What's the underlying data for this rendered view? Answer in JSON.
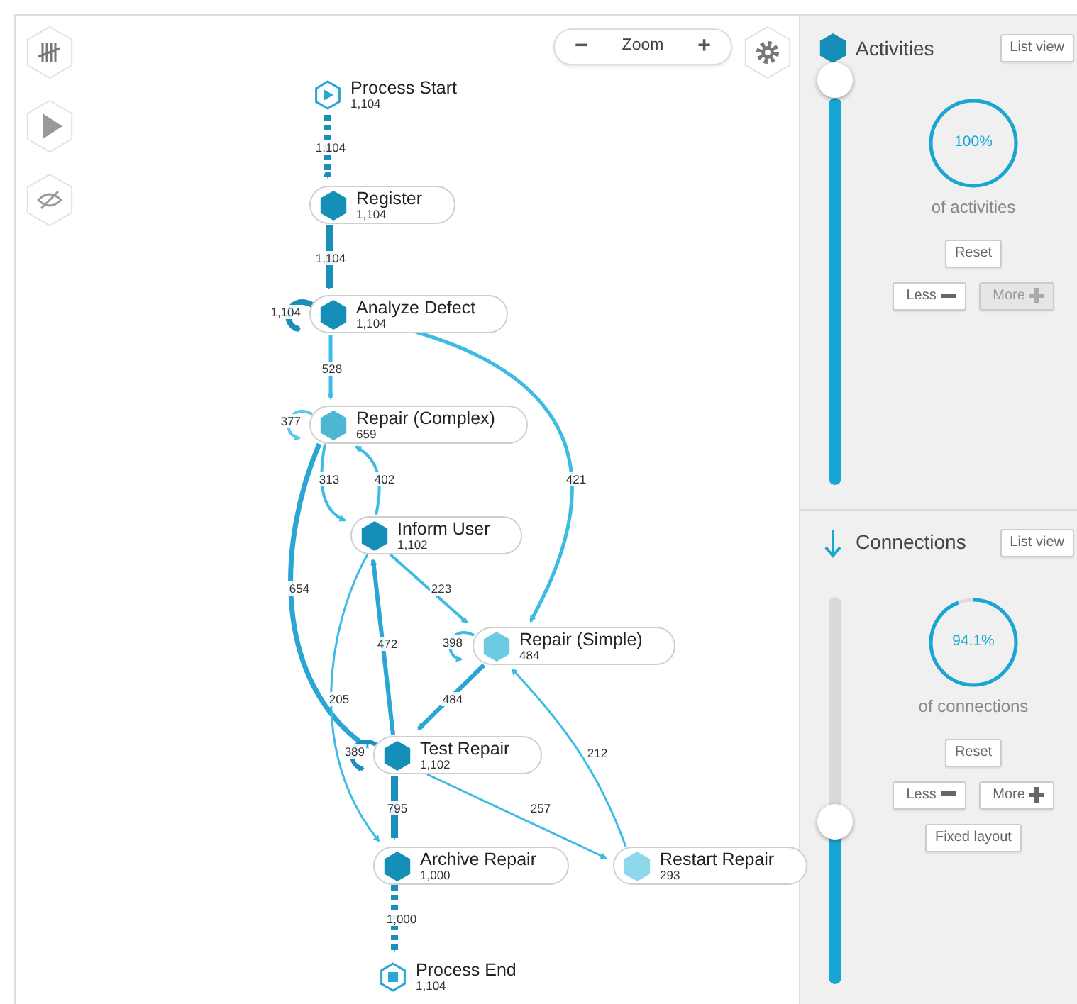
{
  "zoom": {
    "minus": "−",
    "label": "Zoom",
    "plus": "+"
  },
  "nodes": [
    {
      "kind": "start",
      "name": "Process Start",
      "count": "1,104"
    },
    {
      "kind": "activity",
      "name": "Register",
      "count": "1,104",
      "color": "#168fb8"
    },
    {
      "kind": "activity",
      "name": "Analyze Defect",
      "count": "1,104",
      "color": "#168fb8"
    },
    {
      "kind": "activity",
      "name": "Repair (Complex)",
      "count": "659",
      "color": "#4db7d3"
    },
    {
      "kind": "activity",
      "name": "Inform User",
      "count": "1,102",
      "color": "#168fb8"
    },
    {
      "kind": "activity",
      "name": "Repair (Simple)",
      "count": "484",
      "color": "#6ccbe1"
    },
    {
      "kind": "activity",
      "name": "Test Repair",
      "count": "1,102",
      "color": "#168fb8"
    },
    {
      "kind": "activity",
      "name": "Archive Repair",
      "count": "1,000",
      "color": "#168fb8"
    },
    {
      "kind": "activity",
      "name": "Restart Repair",
      "count": "293",
      "color": "#8ed8ec"
    },
    {
      "kind": "end",
      "name": "Process End",
      "count": "1,104"
    }
  ],
  "edges": [
    {
      "kind": "dashed",
      "label": "1,104"
    },
    {
      "kind": "flow",
      "label": "1,104"
    },
    {
      "kind": "loop",
      "label": "1,104"
    },
    {
      "kind": "flow",
      "label": "528"
    },
    {
      "kind": "flow",
      "label": "421"
    },
    {
      "kind": "loop",
      "label": "377"
    },
    {
      "kind": "flow",
      "label": "313"
    },
    {
      "kind": "flow",
      "label": "402"
    },
    {
      "kind": "flow",
      "label": "654"
    },
    {
      "kind": "flow",
      "label": "223"
    },
    {
      "kind": "loop",
      "label": "398"
    },
    {
      "kind": "flow",
      "label": "484"
    },
    {
      "kind": "flow",
      "label": "205"
    },
    {
      "kind": "flow",
      "label": "472"
    },
    {
      "kind": "loop",
      "label": "389"
    },
    {
      "kind": "flow",
      "label": "795"
    },
    {
      "kind": "flow",
      "label": "257"
    },
    {
      "kind": "flow",
      "label": "212"
    },
    {
      "kind": "dashed",
      "label": "1,000"
    }
  ],
  "panels": [
    {
      "kind": "activities",
      "title": "Activities",
      "list_view": "List view",
      "slider": {
        "level": 1
      },
      "gauge": {
        "reading": "100%",
        "caption": "of activities"
      },
      "buttons": [
        {
          "kind": "reset",
          "label": "Reset",
          "disabled": false
        },
        {
          "kind": "less",
          "label": "Less",
          "disabled": false
        },
        {
          "kind": "more",
          "label": "More",
          "disabled": true
        }
      ]
    },
    {
      "kind": "connections",
      "title": "Connections",
      "list_view": "List view",
      "slider": {
        "level": 0.4
      },
      "gauge": {
        "reading": "94.1%",
        "caption": "of connections"
      },
      "buttons": [
        {
          "kind": "reset",
          "label": "Reset",
          "disabled": false
        },
        {
          "kind": "less",
          "label": "Less",
          "disabled": false
        },
        {
          "kind": "more",
          "label": "More",
          "disabled": false
        },
        {
          "kind": "plain",
          "label": "Fixed layout",
          "disabled": false
        }
      ]
    }
  ]
}
